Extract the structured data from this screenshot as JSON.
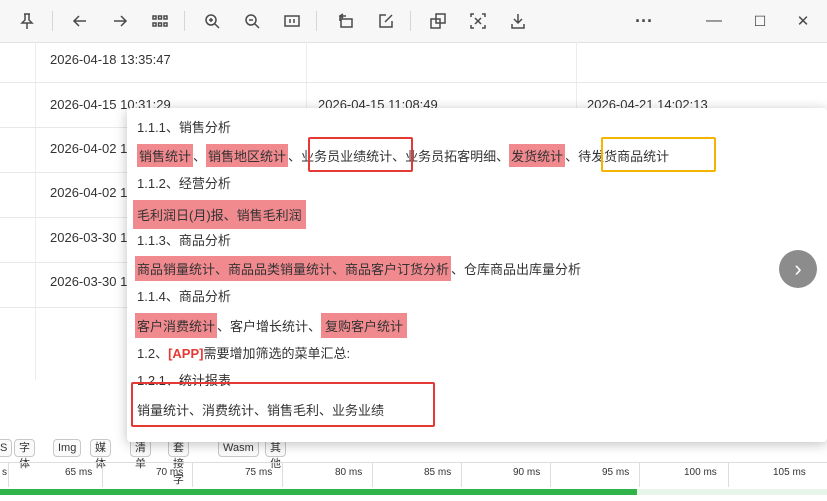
{
  "toolbar": {
    "icons": [
      "pin-icon",
      "back-icon",
      "forward-icon",
      "grid-icon",
      "zoom-in-icon",
      "zoom-out-icon",
      "fit-icon",
      "rotate-icon",
      "edit-icon",
      "copy-icon",
      "scan-icon",
      "download-icon",
      "more-icon",
      "minimize-icon",
      "maximize-icon",
      "close-icon"
    ],
    "more_label": "···",
    "close_label": "✕",
    "maximize_label": "☐",
    "minimize_label": "—"
  },
  "table": {
    "rows": [
      {
        "c1": "2026-04-18 13:35:47",
        "c2": "",
        "c3": ""
      },
      {
        "c1": "2026-04-15 10:31:29",
        "c2": "2026-04-15 11:08:49",
        "c3": "2026-04-21 14:02:13"
      },
      {
        "c1": "2026-04-02 1",
        "c2": "",
        "c3": ""
      },
      {
        "c1": "2026-04-02 1",
        "c2": "",
        "c3": ""
      },
      {
        "c1": "2026-03-30 1",
        "c2": "",
        "c3": ""
      },
      {
        "c1": "2026-03-30 1",
        "c2": "",
        "c3": ""
      }
    ]
  },
  "popup": {
    "h1": "1.1.1、销售分析",
    "l1": {
      "a": "销售统计",
      "s1": "、",
      "b": "销售地区统计",
      "s2": "、",
      "c": "业务员业绩统计",
      "s3": "、业务员拓客明细、",
      "d": "发货统计",
      "s4": "、",
      "e": "待发货商品统计"
    },
    "h2": "1.1.2、经营分析",
    "l2": {
      "a": "毛利润日(月)报、销售毛利润"
    },
    "h3": "1.1.3、商品分析",
    "l3": {
      "a": "商品销量统计、商品品类销量统计、商品客户订货分析",
      "s1": "、仓库商品出库量分析"
    },
    "h4": "1.1.4、商品分析",
    "l4": {
      "a": "客户消费统计",
      "s1": "、客户增长统计、",
      "b": "复购客户统计"
    },
    "h5": {
      "pre": "1.2、",
      "app": "[APP]",
      "post": "需要增加筛选的菜单汇总:"
    },
    "h6": "1.2.1、统计报表",
    "l6": "销量统计、消费统计、销售毛利、业务业绩"
  },
  "filters": [
    "S",
    "字体",
    "Img",
    "媒体",
    "清单",
    "套接字",
    "Wasm",
    "其他"
  ],
  "ticks": [
    "s",
    "65 ms",
    "70 ms",
    "75 ms",
    "80 ms",
    "85 ms",
    "90 ms",
    "95 ms",
    "100 ms",
    "105 ms"
  ],
  "progress": 0.77,
  "next_label": "›"
}
